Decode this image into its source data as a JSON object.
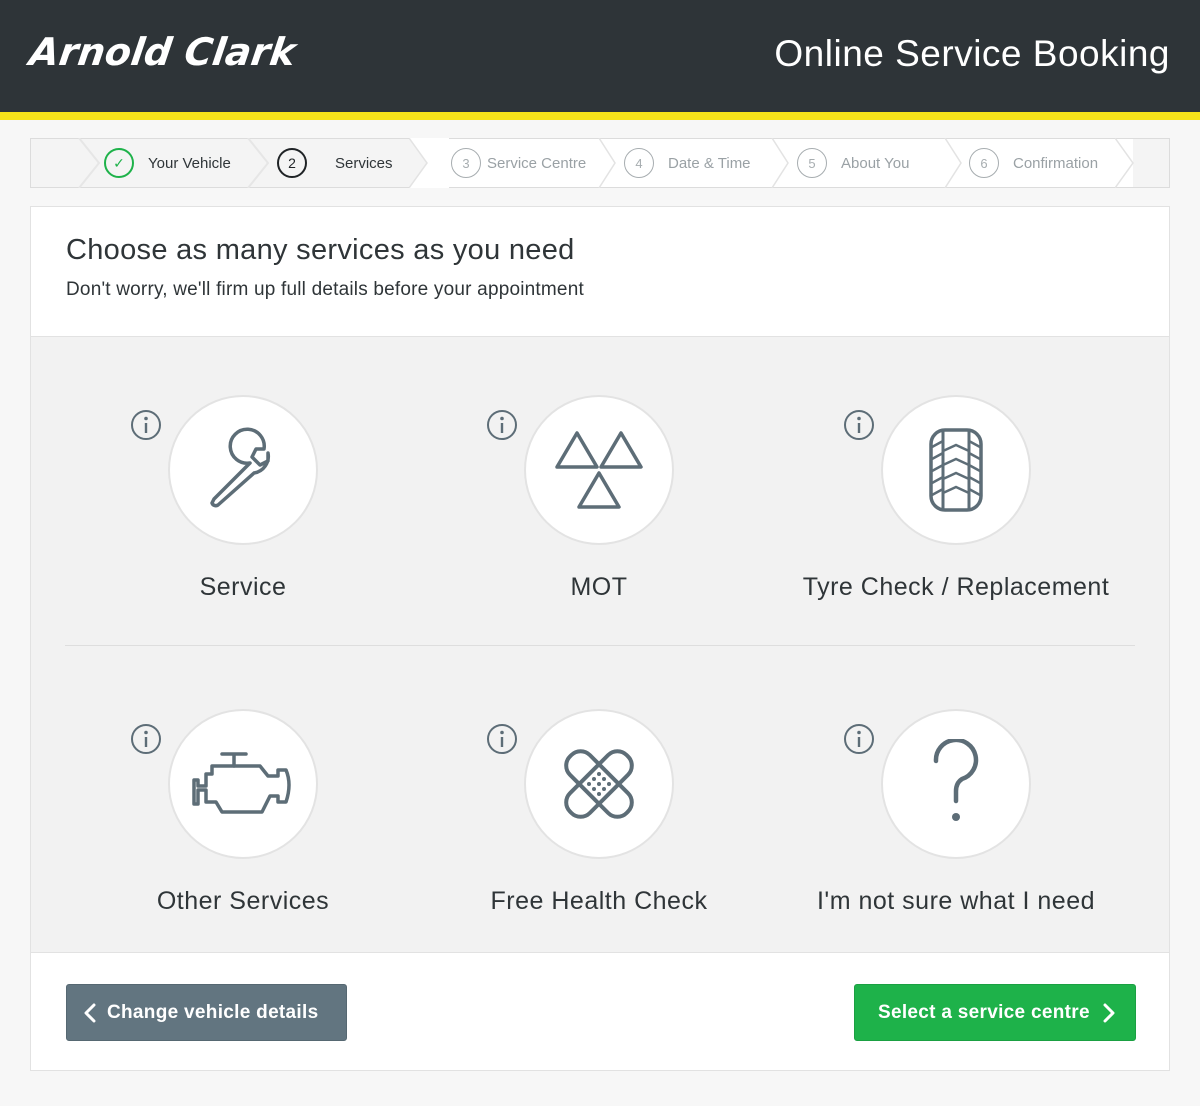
{
  "header": {
    "logo": "Arnold Clark",
    "title": "Online Service Booking",
    "bg_color": "#2e3438",
    "stripe_color": "#f7e31a"
  },
  "steps": [
    {
      "number": "✓",
      "label": "Your Vehicle",
      "state": "done"
    },
    {
      "number": "2",
      "label": "Services",
      "state": "active"
    },
    {
      "number": "3",
      "label": "Service Centre",
      "state": "future"
    },
    {
      "number": "4",
      "label": "Date & Time",
      "state": "future"
    },
    {
      "number": "5",
      "label": "About You",
      "state": "future"
    },
    {
      "number": "6",
      "label": "Confirmation",
      "state": "future"
    }
  ],
  "main": {
    "title": "Choose as many services as you need",
    "subtitle": "Don't worry, we'll firm up full details before your appointment"
  },
  "services": [
    {
      "label": "Service",
      "icon": "wrench-icon"
    },
    {
      "label": "MOT",
      "icon": "mot-triangles-icon"
    },
    {
      "label": "Tyre Check / Replacement",
      "icon": "tyre-icon"
    },
    {
      "label": "Other Services",
      "icon": "engine-icon"
    },
    {
      "label": "Free Health Check",
      "icon": "plaster-icon"
    },
    {
      "label": "I'm not sure what I need",
      "icon": "question-mark-icon"
    }
  ],
  "buttons": {
    "back_label": "Change vehicle details",
    "next_label": "Select a service centre",
    "back_color": "#627580",
    "next_color": "#1eb24a"
  },
  "colors": {
    "accent_green": "#1eb24a",
    "icon_stroke": "#5d6d77"
  }
}
